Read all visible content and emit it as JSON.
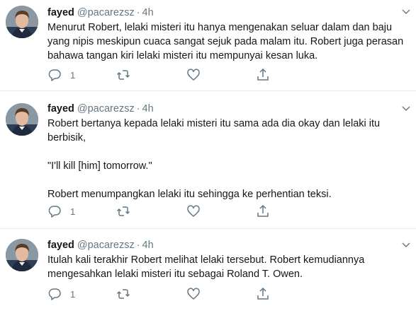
{
  "tweets": [
    {
      "name": "fayed",
      "handle": "@pacarezsz",
      "separator": "·",
      "time": "4h",
      "paragraphs": [
        "Menurut Robert, lelaki misteri itu hanya mengenakan seluar dalam dan baju yang nipis meskipun cuaca sangat sejuk pada malam itu. Robert juga perasan bahawa tangan kiri lelaki misteri itu mempunyai kesan luka."
      ],
      "reply_count": "1",
      "icons": {
        "avatar": "profile-photo",
        "reply": "reply-icon",
        "retweet": "retweet-icon",
        "like": "heart-icon",
        "share": "share-icon",
        "menu": "chevron-down-icon"
      }
    },
    {
      "name": "fayed",
      "handle": "@pacarezsz",
      "separator": "·",
      "time": "4h",
      "paragraphs": [
        "Robert bertanya kepada lelaki misteri itu sama ada dia okay dan lelaki itu berbisik,",
        "\"I'll kill [him] tomorrow.\"",
        "Robert menumpangkan lelaki itu sehingga ke  perhentian teksi."
      ],
      "reply_count": "1"
    },
    {
      "name": "fayed",
      "handle": "@pacarezsz",
      "separator": "·",
      "time": "4h",
      "paragraphs": [
        "Itulah kali terakhir Robert melihat lelaki tersebut. Robert kemudiannya mengesahkan lelaki misteri itu sebagai Roland T. Owen."
      ],
      "reply_count": "1"
    }
  ],
  "colors": {
    "text": "#14171a",
    "secondary": "#657786",
    "divider": "#e6ecf0"
  }
}
